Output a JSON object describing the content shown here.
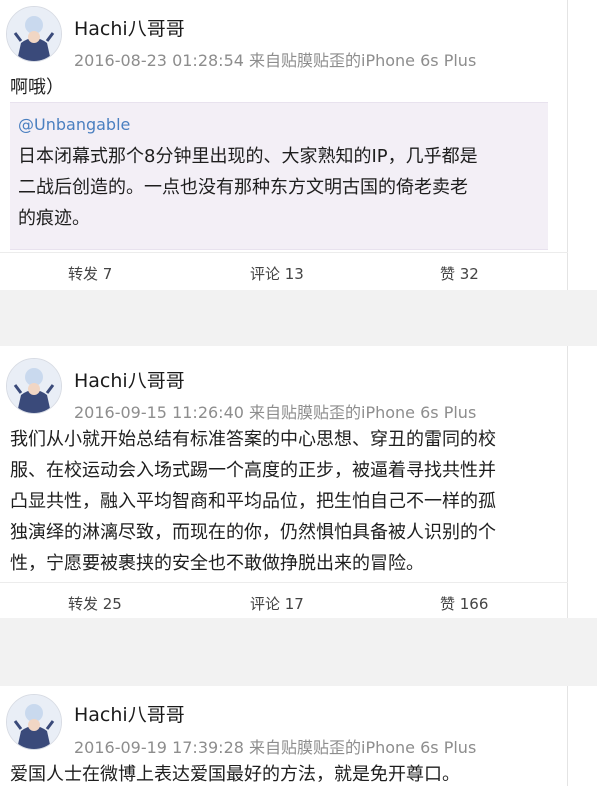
{
  "posts": [
    {
      "user": "Hachi八哥哥",
      "meta": "2016-08-23 01:28:54  来自贴膜贴歪的iPhone 6s Plus",
      "text_lines": [
        "啊哦）"
      ],
      "quote": {
        "mention": "@Unbangable",
        "lines": [
          "日本闭幕式那个8分钟里出现的、大家熟知的IP，几乎都是",
          "二战后创造的。一点也没有那种东方文明古国的倚老卖老",
          "的痕迹。"
        ]
      },
      "actions": {
        "repost": "转发 7",
        "comment": "评论 13",
        "like": "赞 32"
      }
    },
    {
      "user": "Hachi八哥哥",
      "meta": "2016-09-15 11:26:40  来自贴膜贴歪的iPhone 6s Plus",
      "text_lines": [
        "我们从小就开始总结有标准答案的中心思想、穿丑的雷同的校",
        "服、在校运动会入场式踢一个高度的正步，被逼着寻找共性并",
        "凸显共性，融入平均智商和平均品位，把生怕自己不一样的孤",
        "独演绎的淋漓尽致，而现在的你，仍然惧怕具备被人识别的个",
        "性，宁愿要被裹挟的安全也不敢做挣脱出来的冒险。"
      ],
      "actions": {
        "repost": "转发 25",
        "comment": "评论 17",
        "like": "赞 166"
      }
    },
    {
      "user": "Hachi八哥哥",
      "meta": "2016-09-19 17:39:28  来自贴膜贴歪的iPhone 6s Plus",
      "text_lines": [
        "爱国人士在微博上表达爱国最好的方法，就是免开尊口。"
      ]
    }
  ],
  "colors": {
    "link": "#4a7fc0",
    "meta": "#8d8d8d",
    "quote_bg": "#f3eff6"
  },
  "icons": [
    "avatar"
  ]
}
